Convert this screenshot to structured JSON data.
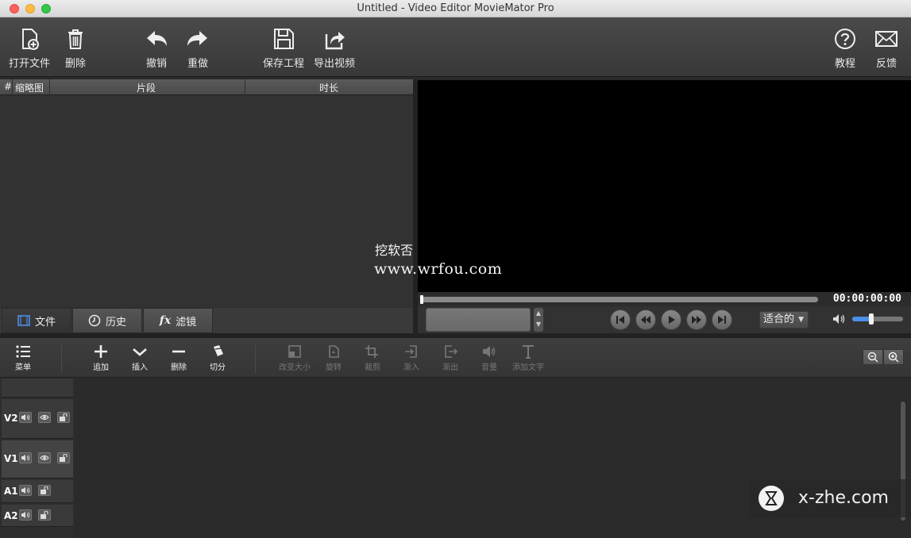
{
  "window": {
    "title": "Untitled - Video Editor MovieMator Pro"
  },
  "toolbar": {
    "open_file": "打开文件",
    "delete": "删除",
    "undo": "撤销",
    "redo": "重做",
    "save_project": "保存工程",
    "export_video": "导出视频",
    "tutorial": "教程",
    "feedback": "反馈"
  },
  "media": {
    "columns": [
      "#",
      "缩略图",
      "片段",
      "时长"
    ],
    "tabs": [
      "文件",
      "历史",
      "滤镜"
    ],
    "filter_tab_prefix": "fx"
  },
  "preview": {
    "timecode": "00:00:00:00",
    "zoom_fit": "适合的",
    "volume_level": 0.35,
    "position": 0
  },
  "timeline_toolbar": {
    "menu": "菜单",
    "append": "追加",
    "insert": "插入",
    "remove": "删除",
    "split": "切分",
    "resize": "改变大小",
    "rotate": "旋转",
    "crop": "裁剪",
    "fade_in": "渐入",
    "fade_out": "渐出",
    "volume": "音量",
    "add_text": "添加文字"
  },
  "tracks": [
    {
      "name": "V2",
      "type": "video"
    },
    {
      "name": "V1",
      "type": "video"
    },
    {
      "name": "A1",
      "type": "audio"
    },
    {
      "name": "A2",
      "type": "audio"
    }
  ],
  "watermarks": {
    "cn": "挖软否",
    "url": "www.wrfou.com",
    "brand": "x-zhe.com"
  },
  "colors": {
    "accent": "#4c8fe8",
    "preview_bg": "#000000"
  }
}
